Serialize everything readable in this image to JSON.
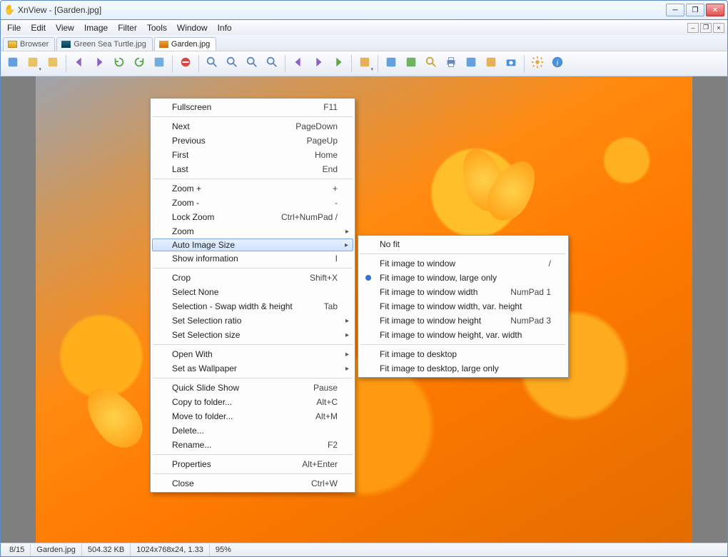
{
  "title": "XnView - [Garden.jpg]",
  "menubar": [
    "File",
    "Edit",
    "View",
    "Image",
    "Filter",
    "Tools",
    "Window",
    "Info"
  ],
  "tabs": [
    {
      "label": "Browser",
      "icon": "browser"
    },
    {
      "label": "Green Sea Turtle.jpg",
      "icon": "img1"
    },
    {
      "label": "Garden.jpg",
      "icon": "img2",
      "active": true
    }
  ],
  "context_menu": [
    {
      "type": "item",
      "label": "Fullscreen",
      "shortcut": "F11"
    },
    {
      "type": "sep"
    },
    {
      "type": "item",
      "label": "Next",
      "shortcut": "PageDown"
    },
    {
      "type": "item",
      "label": "Previous",
      "shortcut": "PageUp"
    },
    {
      "type": "item",
      "label": "First",
      "shortcut": "Home"
    },
    {
      "type": "item",
      "label": "Last",
      "shortcut": "End"
    },
    {
      "type": "sep"
    },
    {
      "type": "item",
      "label": "Zoom +",
      "shortcut": "+"
    },
    {
      "type": "item",
      "label": "Zoom -",
      "shortcut": "-"
    },
    {
      "type": "item",
      "label": "Lock Zoom",
      "shortcut": "Ctrl+NumPad /"
    },
    {
      "type": "item",
      "label": "Zoom",
      "sub": true
    },
    {
      "type": "item",
      "label": "Auto Image Size",
      "sub": true,
      "highlight": true
    },
    {
      "type": "item",
      "label": "Show information",
      "shortcut": "I"
    },
    {
      "type": "sep"
    },
    {
      "type": "item",
      "label": "Crop",
      "shortcut": "Shift+X"
    },
    {
      "type": "item",
      "label": "Select None"
    },
    {
      "type": "item",
      "label": "Selection - Swap width & height",
      "shortcut": "Tab"
    },
    {
      "type": "item",
      "label": "Set Selection ratio",
      "sub": true
    },
    {
      "type": "item",
      "label": "Set Selection size",
      "sub": true
    },
    {
      "type": "sep"
    },
    {
      "type": "item",
      "label": "Open With",
      "sub": true
    },
    {
      "type": "item",
      "label": "Set as Wallpaper",
      "sub": true
    },
    {
      "type": "sep"
    },
    {
      "type": "item",
      "label": "Quick Slide Show",
      "shortcut": "Pause"
    },
    {
      "type": "item",
      "label": "Copy to folder...",
      "shortcut": "Alt+C"
    },
    {
      "type": "item",
      "label": "Move to folder...",
      "shortcut": "Alt+M"
    },
    {
      "type": "item",
      "label": "Delete..."
    },
    {
      "type": "item",
      "label": "Rename...",
      "shortcut": "F2"
    },
    {
      "type": "sep"
    },
    {
      "type": "item",
      "label": "Properties",
      "shortcut": "Alt+Enter"
    },
    {
      "type": "sep"
    },
    {
      "type": "item",
      "label": "Close",
      "shortcut": "Ctrl+W"
    }
  ],
  "submenu": [
    {
      "type": "item",
      "label": "No fit"
    },
    {
      "type": "sep"
    },
    {
      "type": "item",
      "label": "Fit image to window",
      "shortcut": "/"
    },
    {
      "type": "item",
      "label": "Fit image to window, large only",
      "radio": true
    },
    {
      "type": "item",
      "label": "Fit image to window width",
      "shortcut": "NumPad 1"
    },
    {
      "type": "item",
      "label": "Fit image to window width, var. height"
    },
    {
      "type": "item",
      "label": "Fit image to window height",
      "shortcut": "NumPad 3"
    },
    {
      "type": "item",
      "label": "Fit image to window height, var. width"
    },
    {
      "type": "sep"
    },
    {
      "type": "item",
      "label": "Fit image to desktop"
    },
    {
      "type": "item",
      "label": "Fit image to desktop, large only"
    }
  ],
  "status": {
    "index": "8/15",
    "filename": "Garden.jpg",
    "filesize": "504.32 KB",
    "dims": "1024x768x24, 1.33",
    "zoom": "95%"
  },
  "toolbar_icons": [
    "browse-mode",
    "open-folder-drop",
    "open-folder",
    "sep",
    "back",
    "forward",
    "rotate-left",
    "rotate-right",
    "monitor",
    "sep",
    "no-entry",
    "sep",
    "zoom-in",
    "zoom-100",
    "zoom-fit",
    "zoom-out",
    "sep",
    "prev-file",
    "next-file",
    "play",
    "sep",
    "image-drop",
    "sep",
    "fit-window",
    "fit-desktop",
    "find",
    "print",
    "scan",
    "pictures",
    "camera",
    "sep",
    "settings",
    "info"
  ]
}
